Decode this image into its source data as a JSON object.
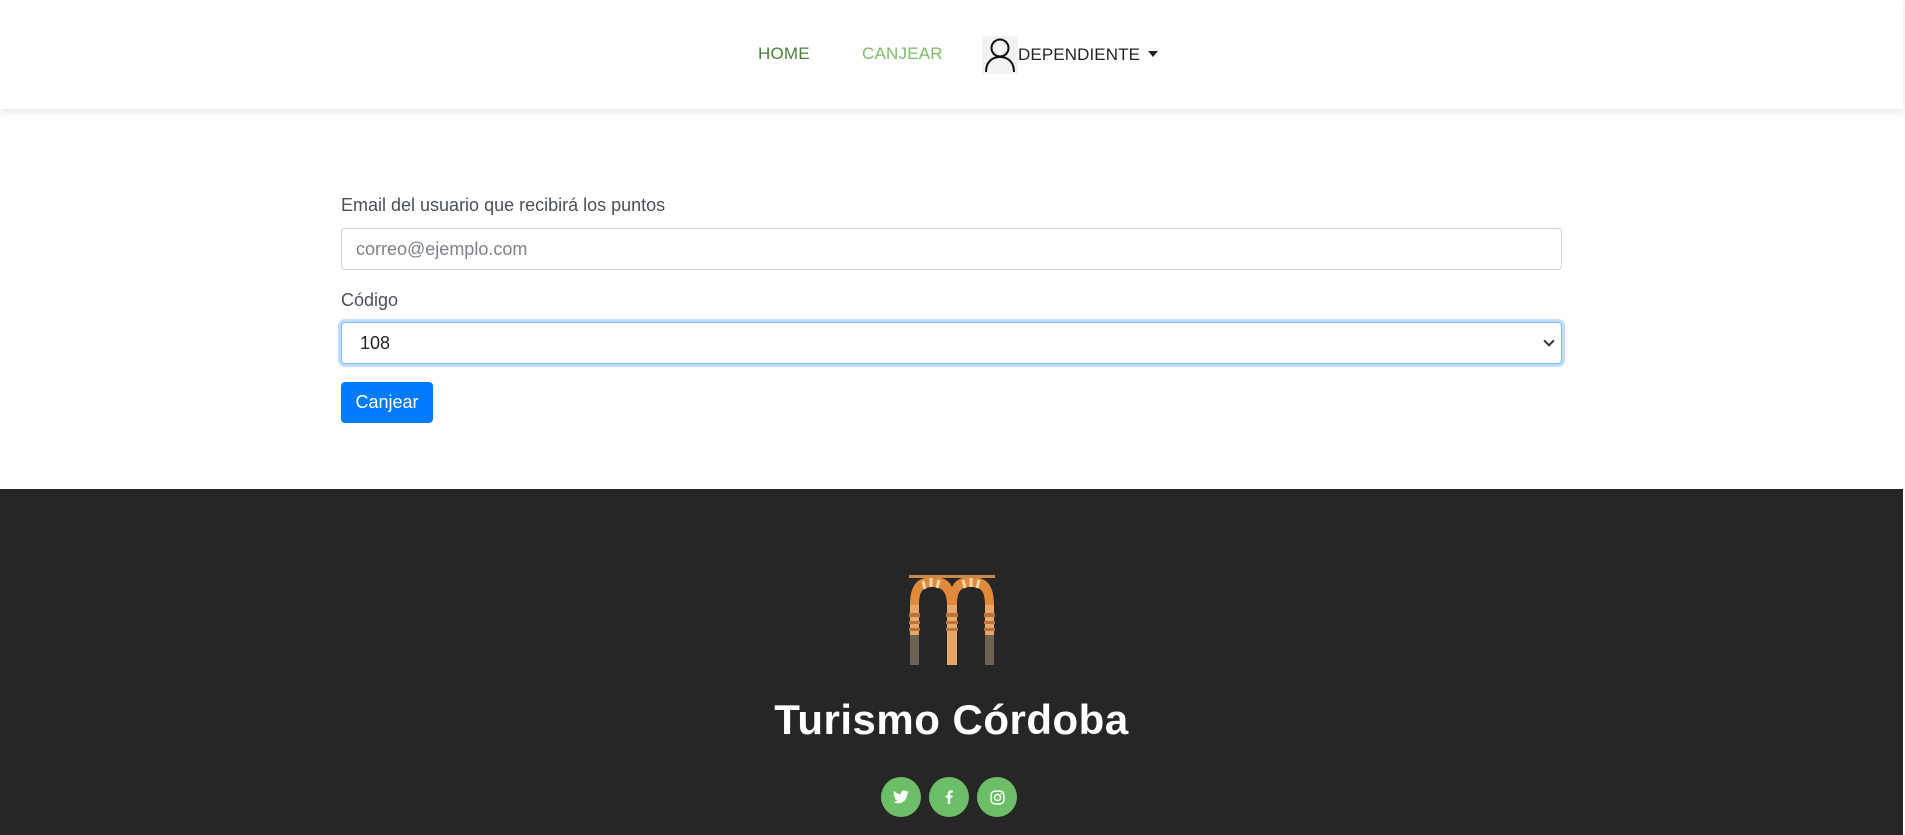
{
  "nav": {
    "home_label": "HOME",
    "canjear_label": "CANJEAR",
    "user_label": "DEPENDIENTE",
    "colors": {
      "home": "#4a7f3a",
      "active": "#7dbb6a"
    }
  },
  "form": {
    "email_label": "Email del usuario que recibirá los puntos",
    "email_placeholder": "correo@ejemplo.com",
    "email_value": "",
    "codigo_label": "Código",
    "codigo_value": "108",
    "submit_label": "Canjear",
    "accent_color": "#007bff"
  },
  "footer": {
    "title": "Turismo Córdoba",
    "logo": "mezquita-arches-logo",
    "social": [
      {
        "icon": "twitter-icon",
        "glyph": "t"
      },
      {
        "icon": "facebook-icon",
        "glyph": "f"
      },
      {
        "icon": "instagram-icon",
        "glyph": "◎"
      }
    ],
    "background": "#262626",
    "social_color": "#6cbf67"
  }
}
